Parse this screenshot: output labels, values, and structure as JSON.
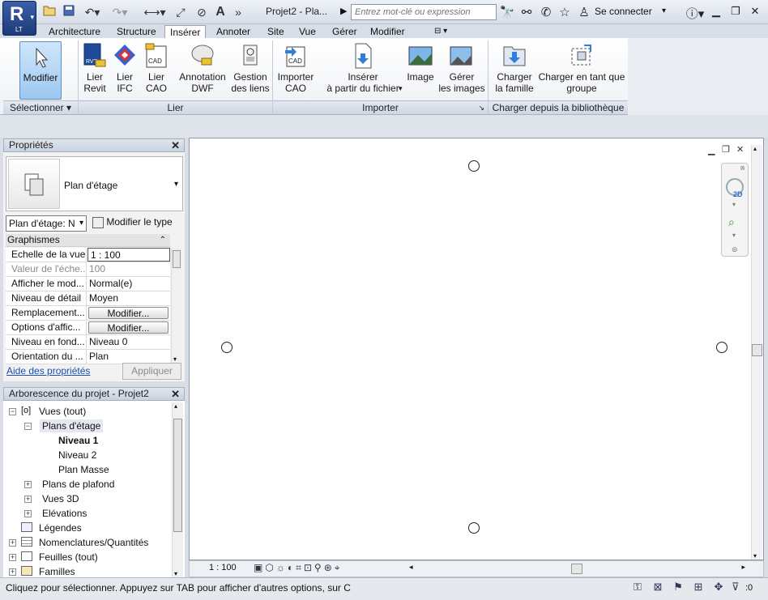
{
  "app": {
    "logo_text": "LT",
    "document_title": "Projet2 - Pla..."
  },
  "search": {
    "placeholder": "Entrez mot-clé ou expression"
  },
  "account": {
    "signin_label": "Se connecter"
  },
  "tabs": [
    {
      "label": "Architecture"
    },
    {
      "label": "Structure"
    },
    {
      "label": "Insérer"
    },
    {
      "label": "Annoter"
    },
    {
      "label": "Site"
    },
    {
      "label": "Vue"
    },
    {
      "label": "Gérer"
    },
    {
      "label": "Modifier"
    }
  ],
  "ribbon": {
    "modify": {
      "label": "Modifier"
    },
    "buttons": [
      {
        "line1": "Lier",
        "line2": "Revit"
      },
      {
        "line1": "Lier",
        "line2": "IFC"
      },
      {
        "line1": "Lier",
        "line2": "CAO"
      },
      {
        "line1": "Annotation",
        "line2": "DWF"
      },
      {
        "line1": "Gestion",
        "line2": "des liens"
      },
      {
        "line1": "Importer",
        "line2": "CAO"
      },
      {
        "line1": "Insérer",
        "line2": "à partir du fichier"
      },
      {
        "line1": "Image",
        "line2": ""
      },
      {
        "line1": "Gérer",
        "line2": "les images"
      },
      {
        "line1": "Charger",
        "line2": "la famille"
      },
      {
        "line1": "Charger en tant que",
        "line2": "groupe"
      }
    ],
    "panels": {
      "select": "Sélectionner",
      "link": "Lier",
      "import": "Importer",
      "library": "Charger depuis la bibliothèque"
    },
    "icon_labels": {
      "rvt": "RVT",
      "cad": "CAD"
    }
  },
  "properties": {
    "title": "Propriétés",
    "type_name": "Plan d'étage",
    "instance_selector": "Plan d'étage: N",
    "edit_type": "Modifier le type",
    "group": "Graphismes",
    "rows": [
      {
        "key": "Echelle de la vue",
        "value": "1 : 100"
      },
      {
        "key": "Valeur de l'éche...",
        "value": "100"
      },
      {
        "key": "Afficher le mod...",
        "value": "Normal(e)"
      },
      {
        "key": "Niveau de détail",
        "value": "Moyen"
      },
      {
        "key": "Remplacement...",
        "value": "Modifier..."
      },
      {
        "key": "Options d'affic...",
        "value": "Modifier..."
      },
      {
        "key": "Niveau en fond...",
        "value": "Niveau 0"
      },
      {
        "key": "Orientation du ...",
        "value": "Plan"
      }
    ],
    "help_link": "Aide des propriétés",
    "apply": "Appliquer"
  },
  "browser": {
    "title": "Arborescence du projet - Projet2",
    "nodes": [
      {
        "label": "Vues (tout)"
      },
      {
        "label": "Plans d'étage"
      },
      {
        "label": "Niveau 1"
      },
      {
        "label": "Niveau 2"
      },
      {
        "label": "Plan Masse"
      },
      {
        "label": "Plans de plafond"
      },
      {
        "label": "Vues 3D"
      },
      {
        "label": "Elévations"
      },
      {
        "label": "Légendes"
      },
      {
        "label": "Nomenclatures/Quantités"
      },
      {
        "label": "Feuilles (tout)"
      },
      {
        "label": "Familles"
      }
    ]
  },
  "view_control": {
    "scale": "1 : 100",
    "nav_2d": "2D"
  },
  "status": {
    "message": "Cliquez pour sélectionner. Appuyez sur TAB pour afficher d'autres options, sur C",
    "filter_count": ":0"
  }
}
